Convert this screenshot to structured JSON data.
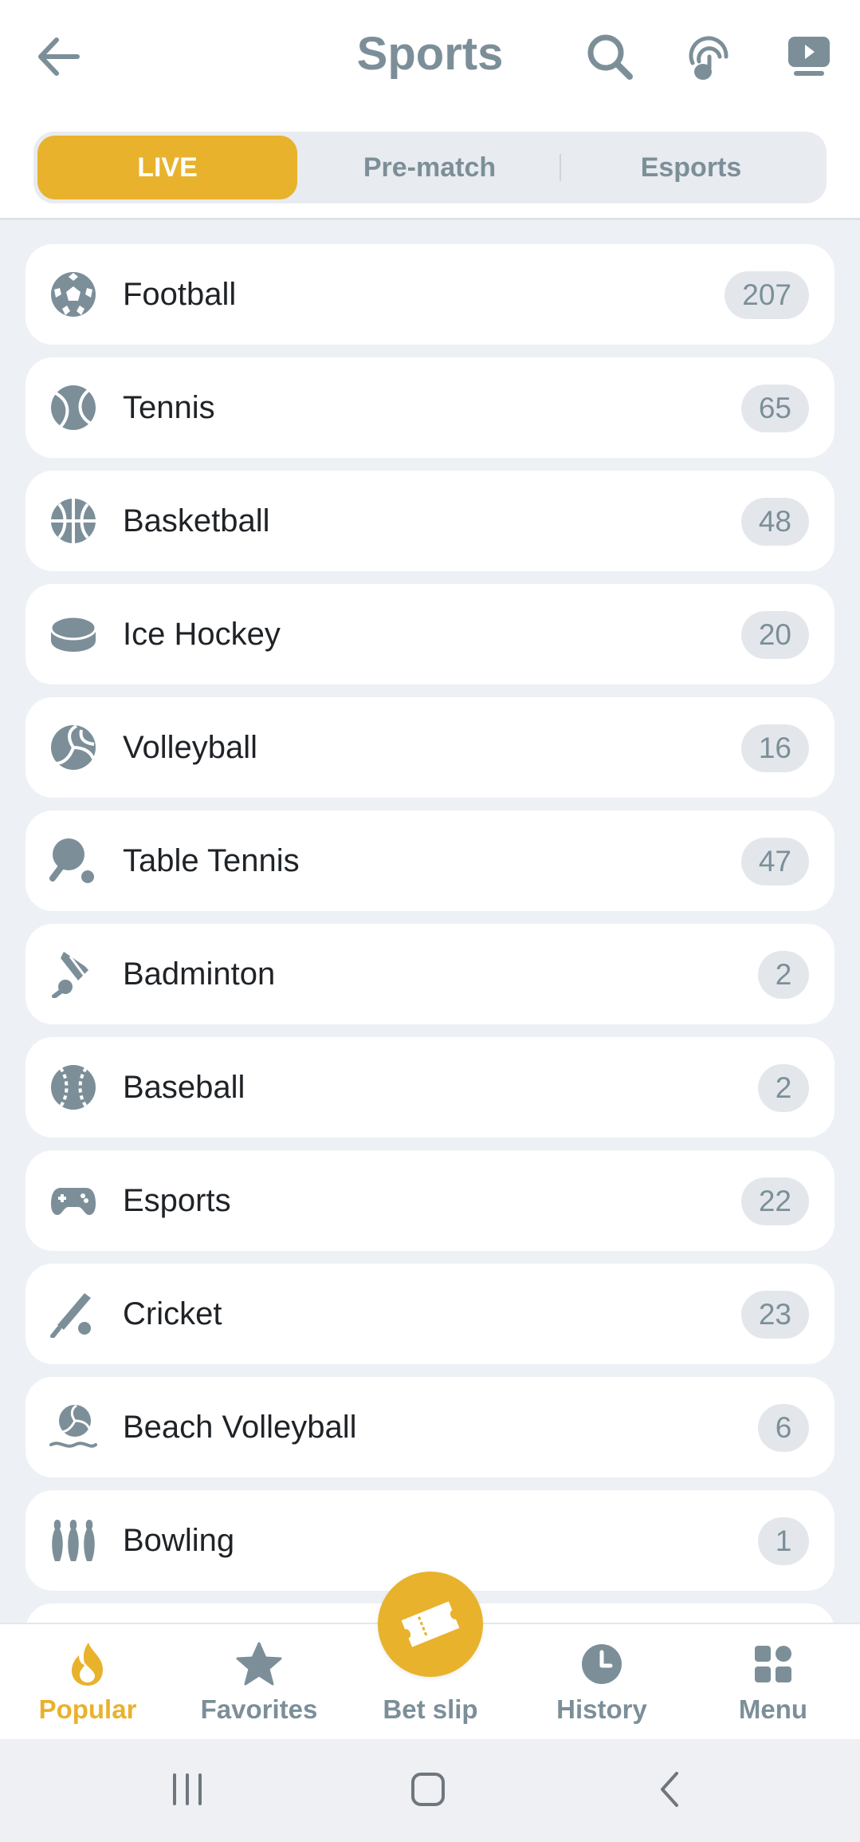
{
  "header": {
    "title": "Sports",
    "back_icon": "arrow-left-icon",
    "search_icon": "search-icon",
    "touch_icon": "touch-id-icon",
    "tv_icon": "tv-icon",
    "icon_color": "#7c8f99"
  },
  "tabs": [
    {
      "label": "LIVE",
      "active": true
    },
    {
      "label": "Pre-match",
      "active": false
    },
    {
      "label": "Esports",
      "active": false
    }
  ],
  "sports": [
    {
      "name": "Football",
      "count": "207",
      "icon": "football-icon"
    },
    {
      "name": "Tennis",
      "count": "65",
      "icon": "tennis-ball-icon"
    },
    {
      "name": "Basketball",
      "count": "48",
      "icon": "basketball-icon"
    },
    {
      "name": "Ice Hockey",
      "count": "20",
      "icon": "hockey-puck-icon"
    },
    {
      "name": "Volleyball",
      "count": "16",
      "icon": "volleyball-icon"
    },
    {
      "name": "Table Tennis",
      "count": "47",
      "icon": "table-tennis-icon"
    },
    {
      "name": "Badminton",
      "count": "2",
      "icon": "shuttlecock-icon"
    },
    {
      "name": "Baseball",
      "count": "2",
      "icon": "baseball-icon"
    },
    {
      "name": "Esports",
      "count": "22",
      "icon": "gamepad-icon"
    },
    {
      "name": "Cricket",
      "count": "23",
      "icon": "cricket-icon"
    },
    {
      "name": "Beach Volleyball",
      "count": "6",
      "icon": "beach-volleyball-icon"
    },
    {
      "name": "Bowling",
      "count": "1",
      "icon": "bowling-pins-icon"
    }
  ],
  "bottom_nav": {
    "popular": "Popular",
    "favorites": "Favorites",
    "betslip": "Bet slip",
    "history": "History",
    "menu": "Menu"
  },
  "colors": {
    "accent": "#e8b22c",
    "muted": "#7c8f99",
    "background": "#edf0f5",
    "card": "#ffffff"
  }
}
